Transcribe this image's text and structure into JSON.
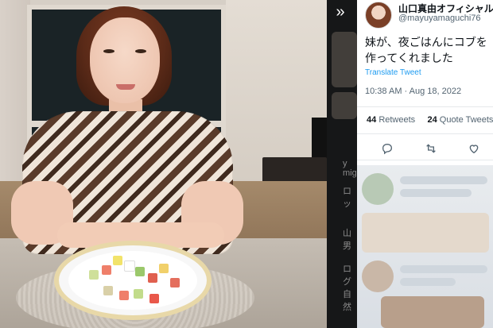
{
  "viewer": {
    "expand_icon": "double-chevron-right-icon",
    "expand_label": "»"
  },
  "tweet": {
    "display_name": "山口真由オフィシャル",
    "handle": "@mayuyamaguchi76",
    "text": "妹が、夜ごはんにコブを作ってくれました",
    "translate_label": "Translate Tweet",
    "timestamp": "10:38 AM · Aug 18, 2022",
    "retweets_count": "44",
    "retweets_label": "Retweets",
    "quote_count": "24",
    "quote_label": "Quote Tweets",
    "actions": [
      {
        "name": "reply-icon"
      },
      {
        "name": "retweet-icon"
      },
      {
        "name": "like-icon"
      }
    ]
  },
  "background_sidebar": {
    "ghost_texts": [
      "y mig",
      "ロッ",
      "山男",
      "ログ",
      "自然"
    ]
  },
  "colors": {
    "link": "#1d9bf0",
    "secondary_text": "#536471",
    "primary_text": "#0f1419"
  }
}
